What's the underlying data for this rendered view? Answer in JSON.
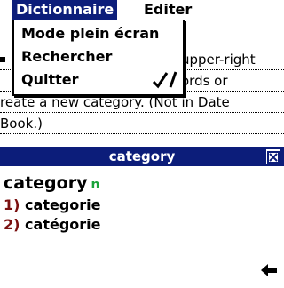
{
  "menubar": {
    "menus": [
      "Dictionnaire",
      "Editer"
    ]
  },
  "dropdown": {
    "items": [
      "Mode plein écran",
      "Rechercher",
      "Quitter"
    ],
    "shortcut_glyph": "✓",
    "shortcut_letter": "/"
  },
  "background_text": {
    "line1_fragment": "upper-right",
    "line2_fragment": "ords or",
    "line3": "reate a new category. (Not in Date",
    "line4": "Book.)"
  },
  "panel": {
    "title": "category",
    "headword": "category",
    "pos": "n",
    "definitions": [
      {
        "num": "1)",
        "text": "categorie"
      },
      {
        "num": "2)",
        "text": "catégorie"
      }
    ]
  },
  "colors": {
    "titlebar": "#0c1d7a",
    "pos": "#1aa33a",
    "numbers": "#7a1010"
  }
}
